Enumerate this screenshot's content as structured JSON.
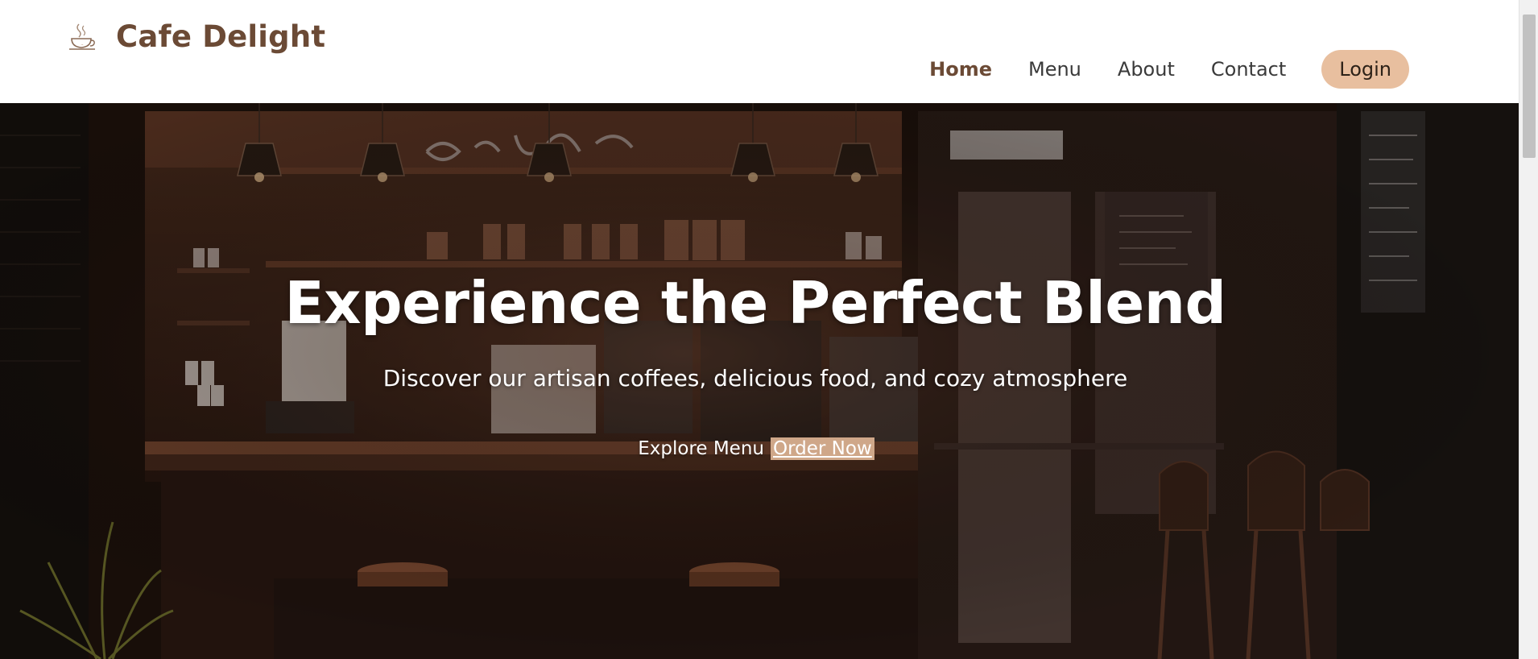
{
  "header": {
    "brand_name": "Cafe Delight",
    "logo_icon": "coffee-cup-logo-icon",
    "nav": {
      "items": [
        {
          "label": "Home",
          "active": true
        },
        {
          "label": "Menu",
          "active": false
        },
        {
          "label": "About",
          "active": false
        },
        {
          "label": "Contact",
          "active": false
        }
      ],
      "login_label": "Login"
    }
  },
  "hero": {
    "title": "Experience the Perfect Blend",
    "subtitle": "Discover our artisan coffees, delicious food, and cozy atmosphere",
    "explore_label": "Explore Menu",
    "order_label": "Order Now",
    "background": "cafe-interior-photo"
  },
  "colors": {
    "brand": "#6b4a35",
    "login_bg": "#e8bf9f",
    "order_bg": "#cfa789",
    "hero_dark": "#1d120c"
  }
}
